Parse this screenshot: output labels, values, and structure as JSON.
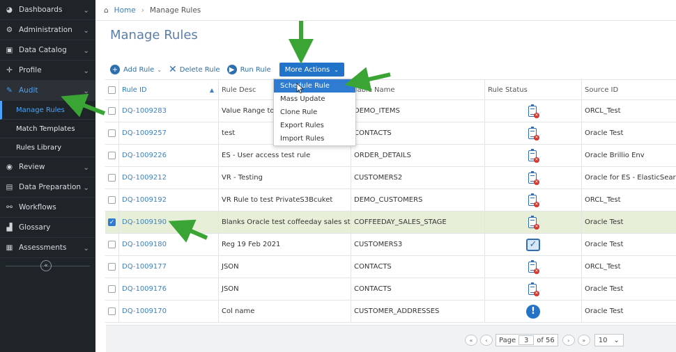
{
  "sidebar": {
    "items": [
      {
        "label": "Dashboards",
        "icon": "dashboard-icon"
      },
      {
        "label": "Administration",
        "icon": "gears-icon"
      },
      {
        "label": "Data Catalog",
        "icon": "catalog-icon"
      },
      {
        "label": "Profile",
        "icon": "crosshair-icon"
      },
      {
        "label": "Audit",
        "icon": "edit-icon"
      },
      {
        "label": "Review",
        "icon": "review-icon"
      },
      {
        "label": "Data Preparation",
        "icon": "data-prep-icon"
      },
      {
        "label": "Workflows",
        "icon": "workflow-icon"
      },
      {
        "label": "Glossary",
        "icon": "glossary-icon"
      },
      {
        "label": "Assessments",
        "icon": "assessments-icon"
      }
    ],
    "audit_sub": [
      "Manage Rules",
      "Match Templates",
      "Rules Library"
    ]
  },
  "breadcrumb": {
    "home": "Home",
    "current": "Manage Rules"
  },
  "page_title": "Manage Rules",
  "toolbar": {
    "add_rule": "Add Rule",
    "delete_rule": "Delete Rule",
    "run_rule": "Run Rule",
    "more_actions": "More Actions"
  },
  "dropdown": [
    "Schedule Rule",
    "Mass Update",
    "Clone Rule",
    "Export Rules",
    "Import Rules"
  ],
  "columns": [
    "Rule ID",
    "Rule Desc",
    "Table Name",
    "Rule Status",
    "Source ID"
  ],
  "rows": [
    {
      "id": "DQ-1009283",
      "desc": "Value Range to te",
      "table": "DEMO_ITEMS",
      "status": "clipboard-error-icon",
      "source": "ORCL_Test",
      "checked": false
    },
    {
      "id": "DQ-1009257",
      "desc": "test",
      "table": "CONTACTS",
      "status": "clipboard-error-icon",
      "source": "Oracle Test",
      "checked": false
    },
    {
      "id": "DQ-1009226",
      "desc": "ES - User access test rule",
      "table": "ORDER_DETAILS",
      "status": "clipboard-error-icon",
      "source": "Oracle Brillio Env",
      "checked": false
    },
    {
      "id": "DQ-1009212",
      "desc": "VR - Testing",
      "table": "CUSTOMERS2",
      "status": "clipboard-error-icon",
      "source": "Oracle for ES - ElasticSearch",
      "checked": false
    },
    {
      "id": "DQ-1009192",
      "desc": "VR Rule to test PrivateS3Bcuket",
      "table": "DEMO_CUSTOMERS",
      "status": "clipboard-error-icon",
      "source": "ORCL_Test",
      "checked": false
    },
    {
      "id": "DQ-1009190",
      "desc": "Blanks Oracle test coffeeday sales stage",
      "table": "COFFEEDAY_SALES_STAGE",
      "status": "clipboard-error-icon",
      "source": "Oracle Test",
      "checked": true
    },
    {
      "id": "DQ-1009180",
      "desc": "Reg 19 Feb 2021",
      "table": "CUSTOMERS3",
      "status": "checkbox-icon",
      "source": "Oracle Test",
      "checked": false
    },
    {
      "id": "DQ-1009177",
      "desc": "JSON",
      "table": "CONTACTS",
      "status": "clipboard-error-icon",
      "source": "ORCL_Test",
      "checked": false
    },
    {
      "id": "DQ-1009176",
      "desc": "JSON",
      "table": "CONTACTS",
      "status": "clipboard-error-icon",
      "source": "Oracle Test",
      "checked": false
    },
    {
      "id": "DQ-1009170",
      "desc": "Col name",
      "table": "CUSTOMER_ADDRESSES",
      "status": "info-icon",
      "source": "Oracle Test",
      "checked": false
    }
  ],
  "pager": {
    "page_label": "Page",
    "page": "3",
    "of_label": "of 56",
    "page_size": "10"
  },
  "colors": {
    "accent": "#2073c8",
    "sidebar_bg": "#1f2428",
    "selected_row": "#e7efd9",
    "arrow": "#3aa535"
  }
}
